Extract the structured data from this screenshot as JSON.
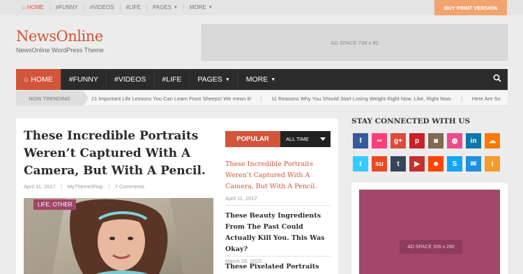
{
  "topbar": {
    "items": [
      {
        "label": "HOME",
        "icon": "home-icon"
      },
      {
        "label": "#FUNNY"
      },
      {
        "label": "#VIDEOS"
      },
      {
        "label": "#LIFE"
      },
      {
        "label": "PAGES",
        "icon": "chevron-down-icon"
      },
      {
        "label": "MORE",
        "icon": "chevron-down-icon"
      }
    ],
    "buy_label": "BUY PRINT VERSION"
  },
  "header": {
    "logo": "NewsOnline",
    "tagline": "NewsOnline WordPress Theme",
    "ad_label": "AD SPACE 728 x 90"
  },
  "nav": {
    "items": [
      {
        "label": "HOME",
        "icon": "home-icon"
      },
      {
        "label": "#FUNNY"
      },
      {
        "label": "#VIDEOS"
      },
      {
        "label": "#LIFE"
      },
      {
        "label": "PAGES",
        "icon": "chevron-down-icon"
      },
      {
        "label": "MORE",
        "icon": "chevron-down-icon"
      }
    ],
    "search_icon": "search-icon"
  },
  "trending": {
    "label": "NOW TRENDING",
    "items": [
      "21 Important Life Lessons You Can Learn From Sheeps! We mean it!",
      "11 Reasons Why You Should Start Losing Weight Right Now. Like, Right Now.",
      "Here Are So"
    ]
  },
  "post": {
    "title": "These Incredible Portraits Weren’t Captured With A Camera, But With A Pencil.",
    "date": "April 11, 2017",
    "author": "MyThemeShop",
    "comments": "7 Comments",
    "categories": "LIFE, OTHER"
  },
  "popular": {
    "tab_label": "POPULAR",
    "range_label": "ALL TIME",
    "items": [
      {
        "title": "These Incredible Portraits Weren’t Captured With A Camera, But With A Pencil.",
        "date": "April 11, 2017"
      },
      {
        "title": "These Beauty Ingredients From The Past Could Actually Kill You. This Was Okay?",
        "date": "March 29, 2015"
      },
      {
        "title": "These Pixelated Portraits Are"
      }
    ]
  },
  "sidebar": {
    "stay_title": "STAY CONNECTED WITH US",
    "socials": [
      {
        "name": "facebook-icon",
        "glyph": "f",
        "color": "#3b5998"
      },
      {
        "name": "flickr-icon",
        "glyph": "••",
        "color": "#ff3f7a"
      },
      {
        "name": "google-plus-icon",
        "glyph": "g+",
        "color": "#dd4b39"
      },
      {
        "name": "pinterest-icon",
        "glyph": "p",
        "color": "#cb2027"
      },
      {
        "name": "instagram-icon",
        "glyph": "◙",
        "color": "#7f6a52"
      },
      {
        "name": "dribbble-icon",
        "glyph": "◍",
        "color": "#ea4c89"
      },
      {
        "name": "linkedin-icon",
        "glyph": "in",
        "color": "#0e76a8"
      },
      {
        "name": "soundcloud-icon",
        "glyph": "☁",
        "color": "#ff7700"
      },
      {
        "name": "twitter-icon",
        "glyph": "t",
        "color": "#33ccff"
      },
      {
        "name": "stumbleupon-icon",
        "glyph": "su",
        "color": "#eb4924"
      },
      {
        "name": "tumblr-icon",
        "glyph": "t",
        "color": "#35465c"
      },
      {
        "name": "youtube-icon",
        "glyph": "▶",
        "color": "#c4302b"
      },
      {
        "name": "reddit-icon",
        "glyph": "☻",
        "color": "#ff4500"
      },
      {
        "name": "skype-icon",
        "glyph": "S",
        "color": "#12a5f4"
      },
      {
        "name": "email-icon",
        "glyph": "✉",
        "color": "#1d90dd"
      },
      {
        "name": "rss-icon",
        "glyph": "≀",
        "color": "#f59a2e"
      }
    ],
    "ad_label": "AD SPACE 336 x 280"
  }
}
